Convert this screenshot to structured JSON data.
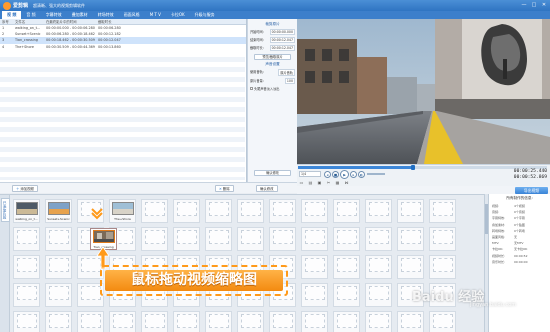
{
  "app": {
    "name": "爱剪辑",
    "document": "超清晰、强大的视频剪辑软件",
    "window_buttons": [
      "—",
      "□",
      "✕"
    ]
  },
  "menu": {
    "tabs": [
      "视 频",
      "音 频",
      "字幕特效",
      "叠加素材",
      "转场特效",
      "画面风格",
      "M T V",
      "卡拉OK",
      "升级与服务"
    ],
    "active_index": 0
  },
  "clip_table": {
    "columns": [
      "序号",
      "文件名",
      "在最终影片中的时间",
      "截取时长"
    ],
    "rows": [
      {
        "idx": "1",
        "name": "walking_on_t...",
        "range": "00:00:00.000 - 00:00:06.280",
        "dur": "00:00:06.280"
      },
      {
        "idx": "2",
        "name": "Sunset+Scenic",
        "range": "00:00:06.280 - 00:00:18.462",
        "dur": "00:00:12.182"
      },
      {
        "idx": "3",
        "name": "Tian_crossing",
        "range": "00:00:18.462 - 00:00:30.509",
        "dur": "00:00:12.047"
      },
      {
        "idx": "4",
        "name": "The+Shore",
        "range": "00:00:30.509 - 00:00:44.369",
        "dur": "00:00:13.860"
      }
    ],
    "selected_index": 2
  },
  "props": {
    "section1": "裁剪原片",
    "start_label": "开始时间:",
    "start_value": "00:00:00.000",
    "end_label": "结束时间:",
    "end_value": "00:00:12.047",
    "dur_label": "截取时长:",
    "dur_value": "00:00:12.047",
    "preview_button": "预览/截取原片",
    "section2": "声音设置",
    "track_label": "使用音轨:",
    "track_value": "原片音轨",
    "volume_label": "原片音量:",
    "volume_value": "100",
    "fade_label": "头尾声音淡入淡出",
    "apply_button": "确认修改"
  },
  "player": {
    "progress": 0.46,
    "zoom_value": "1/4",
    "buttons": [
      "◂",
      "■",
      "▶",
      "▸",
      "◐"
    ],
    "time_current": "00:00:25.440",
    "time_total": "00:00:52.869",
    "tool_icons": [
      "▭",
      "▤",
      "▣",
      "✂",
      "▦",
      "⋈"
    ]
  },
  "toolbar": {
    "add_video": "添加视频",
    "delete": "删除",
    "confirm": "确认修改",
    "export": "导出视频"
  },
  "storyboard": {
    "side_tab": "已添加片段",
    "clips": [
      {
        "name": "walking_on_t..."
      },
      {
        "name": "Sunset+Scenic"
      },
      {
        "name": "Tian_crossing"
      },
      {
        "name": "The+Shore"
      }
    ],
    "dragging_caption": "Tian_crossing",
    "callout": "鼠标拖动视频缩略图"
  },
  "info": {
    "title": "所有制作的信息:",
    "rows": [
      {
        "k": "视频:",
        "v": "4个视频"
      },
      {
        "k": "音频:",
        "v": "0个音频"
      },
      {
        "k": "字幕特效:",
        "v": "0个字幕"
      },
      {
        "k": "叠加素材:",
        "v": "0个贴图"
      },
      {
        "k": "转场特效:",
        "v": "0个转场"
      },
      {
        "k": "画面风格:",
        "v": "无"
      },
      {
        "k": "MTV:",
        "v": "无MTV"
      },
      {
        "k": "卡拉OK:",
        "v": "无卡拉OK"
      },
      {
        "k": "视频时长:",
        "v": "00:00:52"
      },
      {
        "k": "音乐时长:",
        "v": "00:00:00"
      }
    ]
  },
  "watermark": {
    "text": "Baidu 经验",
    "sub": "jingyan.baidu.com"
  }
}
